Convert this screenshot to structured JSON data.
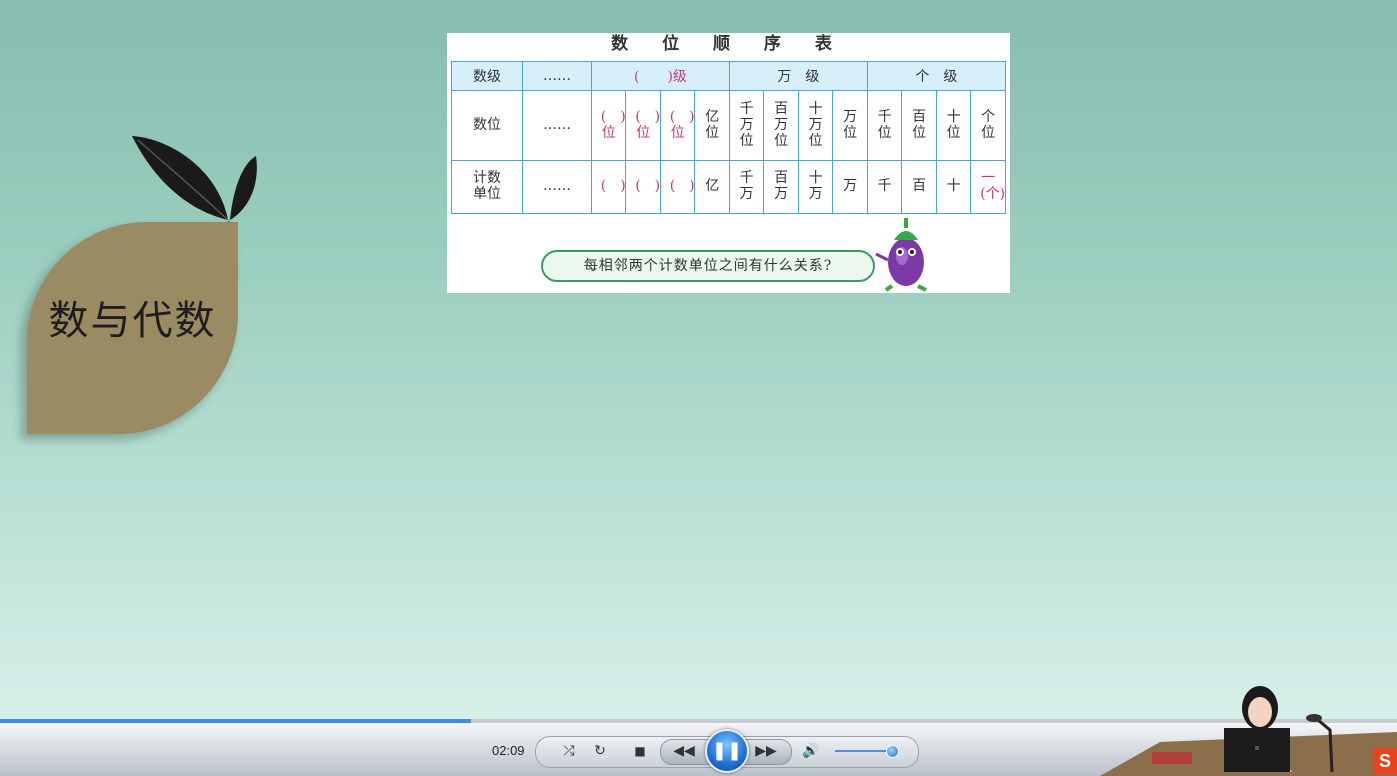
{
  "slide": {
    "table_title": "数 位 顺 序 表",
    "header_row": [
      "数级",
      "……",
      "(　　)级",
      "万　级",
      "个　级"
    ],
    "place_row": {
      "label": "数位",
      "dots": "……",
      "cells": [
        "(　)位",
        "(　)位",
        "(　)位",
        "亿位",
        "千万位",
        "百万位",
        "十万位",
        "万位",
        "千位",
        "百位",
        "十位",
        "个位"
      ]
    },
    "unit_row": {
      "label": "计数单位",
      "dots": "……",
      "cells": [
        "(　)",
        "(　)",
        "(　)",
        "亿",
        "千万",
        "百万",
        "十万",
        "万",
        "千",
        "百",
        "十",
        "一(个)"
      ]
    },
    "bubble_text": "每相邻两个计数单位之间有什么关系?",
    "side_title": "数与代数"
  },
  "player": {
    "time": "02:09",
    "progress_fraction": 0.337,
    "volume_fraction": 0.9,
    "icons": [
      "shuffle-icon",
      "repeat-icon",
      "stop-icon",
      "rewind-icon",
      "pause-icon",
      "fast-forward-icon",
      "volume-icon"
    ],
    "logo": "S"
  },
  "colors": {
    "table_border": "#4aa5d4",
    "header_bg": "#d7eff9",
    "paren": "#c2387a",
    "leaf": "#9a8b63",
    "accent": "#1e6fd0"
  }
}
